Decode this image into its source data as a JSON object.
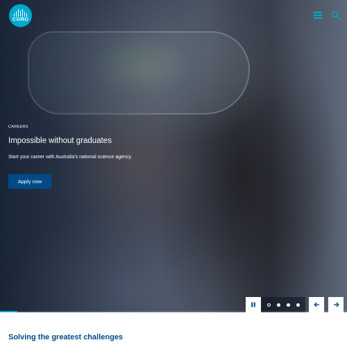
{
  "brand": {
    "logo_text": "CSIRO",
    "logo_color": "#00a9ce"
  },
  "header": {
    "menu_icon": "hamburger-menu-icon",
    "search_icon": "search-icon"
  },
  "hero": {
    "eyebrow": "CAREERS",
    "headline": "Impossible without graduates",
    "description": "Start your career with Australia's national science agency.",
    "cta_label": "Apply now",
    "cta_color": "#004b87"
  },
  "carousel": {
    "pause_icon": "pause-icon",
    "prev_icon": "arrow-left-icon",
    "next_icon": "arrow-right-icon",
    "slide_count": 4,
    "active_slide": 1,
    "progress": 0.05,
    "progress_color": "#00a9ce"
  },
  "section": {
    "title": "Solving the greatest challenges",
    "title_color": "#004b87"
  }
}
